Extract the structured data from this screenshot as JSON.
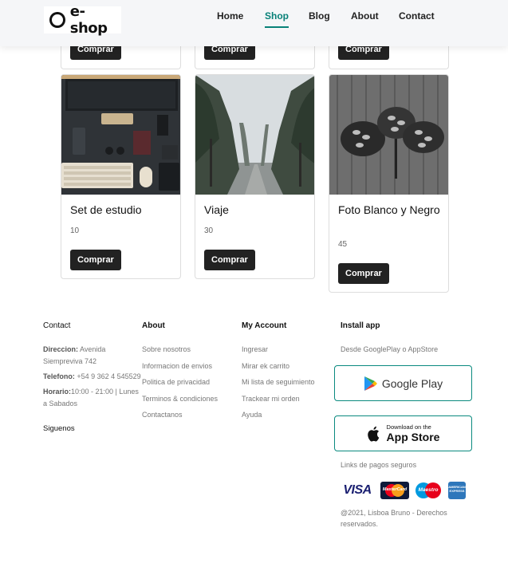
{
  "header": {
    "logo_text": "e-shop",
    "nav": [
      {
        "label": "Home"
      },
      {
        "label": "Shop"
      },
      {
        "label": "Blog"
      },
      {
        "label": "About"
      },
      {
        "label": "Contact"
      }
    ]
  },
  "top_row": {
    "buy_label": "Comprar"
  },
  "products": [
    {
      "name": "Set de estudio",
      "price": "10",
      "buy_label": "Comprar"
    },
    {
      "name": "Viaje",
      "price": "30",
      "buy_label": "Comprar"
    },
    {
      "name": "Foto Blanco y Negro",
      "price": "45",
      "buy_label": "Comprar"
    }
  ],
  "footer": {
    "contact": {
      "title": "Contact",
      "address_label": "Direccion:",
      "address": "Avenida Siempreviva 742",
      "phone_label": "Telefono:",
      "phone": "+54 9 362 4 545529",
      "hours_label": "Horario:",
      "hours": "10:00 - 21:00 | Lunes a Sabados",
      "follow": "Siguenos"
    },
    "about": {
      "title": "About",
      "links": [
        "Sobre nosotros",
        "Informacion de envios",
        "Politica de privacidad",
        "Terminos & condiciones",
        "Contactanos"
      ]
    },
    "account": {
      "title": "My Account",
      "links": [
        "Ingresar",
        "Mirar ek carrito",
        "Mi lista de seguimiento",
        "Trackear mi orden",
        "Ayuda"
      ]
    },
    "install": {
      "title": "Install app",
      "subtitle": "Desde GooglePlay o AppStore",
      "google_play": "Google Play",
      "app_store_small": "Download on the",
      "app_store": "App Store",
      "secure_payments": "Links de pagos seguros",
      "cards": {
        "visa": "VISA",
        "mastercard": "MasterCard",
        "maestro": "Maestro",
        "amex": "AMERICAN EXPRESS"
      }
    },
    "copyright": "@2021, Lisboa Bruno - Derechos reservados."
  },
  "colors": {
    "accent": "#088178",
    "button": "#222222"
  }
}
